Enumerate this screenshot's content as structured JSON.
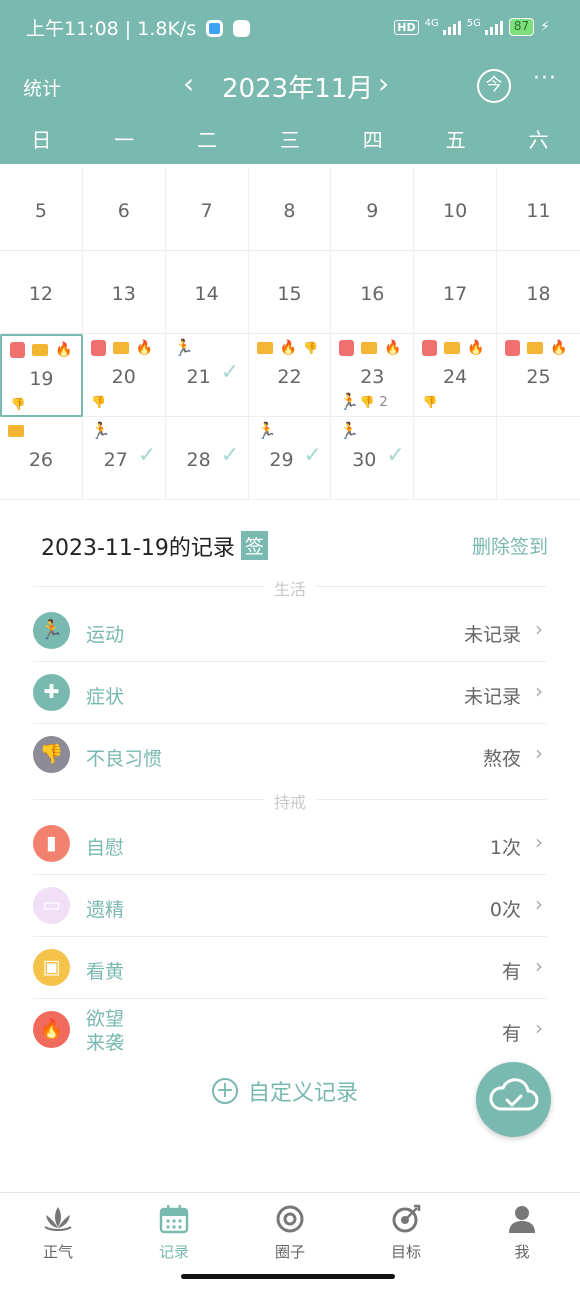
{
  "status_bar": {
    "time": "上午11:08 | 1.8K/s",
    "hd": "HD",
    "net_4g": "4G",
    "net_5g": "5G",
    "battery": "87"
  },
  "nav": {
    "stats_label": "统计",
    "prev": "‹",
    "title": "2023年11月",
    "next": "›",
    "today_label": "今",
    "more": "···"
  },
  "weekdays": [
    "日",
    "一",
    "二",
    "三",
    "四",
    "五",
    "六"
  ],
  "calendar": {
    "weeks": [
      [
        "5",
        "6",
        "7",
        "8",
        "9",
        "10",
        "11"
      ],
      [
        "12",
        "13",
        "14",
        "15",
        "16",
        "17",
        "18"
      ],
      [
        "19",
        "20",
        "21",
        "22",
        "23",
        "24",
        "25"
      ],
      [
        "26",
        "27",
        "28",
        "29",
        "30",
        "",
        ""
      ]
    ],
    "extra_count_23": "2"
  },
  "records": {
    "title": "2023-11-19的记录",
    "tag": "签",
    "delete_label": "删除签到",
    "section_life": "生活",
    "section_abstain": "持戒",
    "life_items": [
      {
        "label": "运动",
        "value": "未记录",
        "icon": "run-icon",
        "color": "#79b9b0"
      },
      {
        "label": "症状",
        "value": "未记录",
        "icon": "medkit-icon",
        "color": "#79b9b0"
      },
      {
        "label": "不良习惯",
        "value": "熬夜",
        "icon": "thumbs-down-icon",
        "color": "#8d8b96"
      }
    ],
    "abstain_items": [
      {
        "label": "自慰",
        "value": "1次",
        "icon": "tissue-roll-icon",
        "color": "#f2826f"
      },
      {
        "label": "遗精",
        "value": "0次",
        "icon": "bed-icon",
        "color": "#f1e0f5"
      },
      {
        "label": "看黄",
        "value": "有",
        "icon": "screen-icon",
        "color": "#f5c24a"
      },
      {
        "label": "欲望\n来袭",
        "value": "有",
        "icon": "fire-icon",
        "color": "#f06b5c"
      }
    ],
    "custom_label": "自定义记录"
  },
  "tabbar": [
    {
      "label": "正气",
      "icon": "lotus-icon",
      "active": false
    },
    {
      "label": "记录",
      "icon": "calendar-icon",
      "active": true
    },
    {
      "label": "圈子",
      "icon": "circle-icon",
      "active": false
    },
    {
      "label": "目标",
      "icon": "target-icon",
      "active": false
    },
    {
      "label": "我",
      "icon": "user-icon",
      "active": false
    }
  ],
  "colors": {
    "accent": "#79b9b0",
    "text": "#333333",
    "muted": "#c8c8c8"
  }
}
